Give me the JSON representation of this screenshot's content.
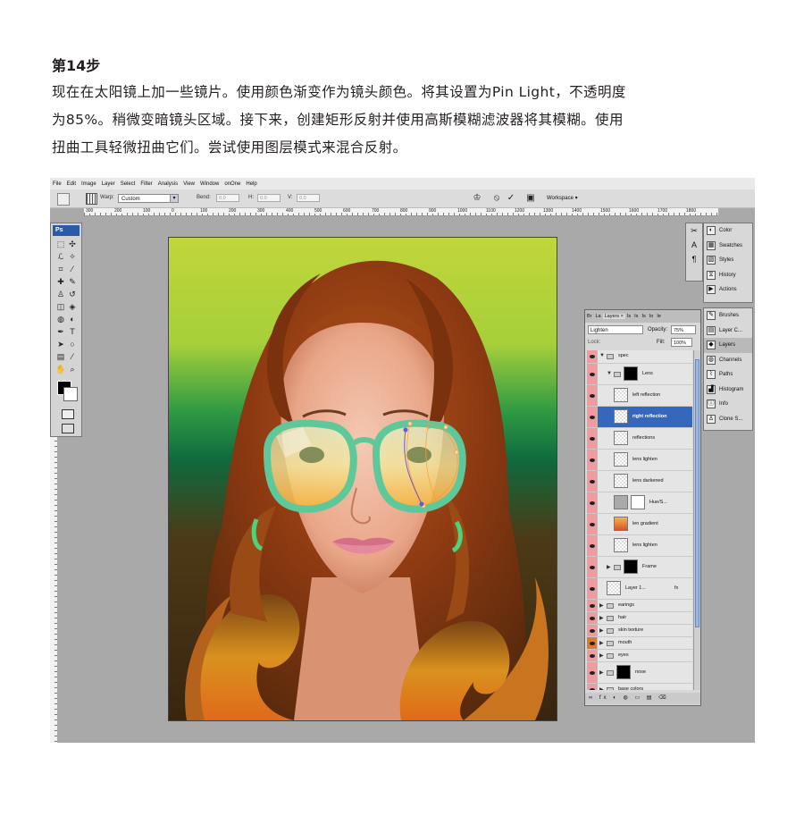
{
  "article": {
    "step_title": "第14步",
    "body_lines": [
      "现在在太阳镜上加一些镜片。使用颜色渐变作为镜头颜色。将其设置为Pin Light，不透明度",
      "为85%。稍微变暗镜头区域。接下来，创建矩形反射并使用高斯模糊滤波器将其模糊。使用",
      "扭曲工具轻微扭曲它们。尝试使用图层模式来混合反射。"
    ]
  },
  "menu": [
    "File",
    "Edit",
    "Image",
    "Layer",
    "Select",
    "Filter",
    "Analysis",
    "View",
    "Window",
    "onOne",
    "Help"
  ],
  "options_bar": {
    "warp_label": "Warp:",
    "warp_value": "Custom",
    "bend_label": "Bend:",
    "bend_value": "0.0",
    "h_label": "H:",
    "h_value": "0.0",
    "v_label": "V:",
    "v_value": "0.0",
    "workspace_label": "Workspace ▾",
    "cancel_icon": "⦸",
    "commit_icon": "✓"
  },
  "ruler_ticks": [
    "300",
    "200",
    "100",
    "0",
    "100",
    "200",
    "300",
    "400",
    "500",
    "600",
    "700",
    "800",
    "900",
    "1000",
    "1100",
    "1200",
    "1300",
    "1400",
    "1500",
    "1600",
    "1700",
    "1800"
  ],
  "toolbox": {
    "logo": "Ps",
    "tools": [
      {
        "icon": "rect-marquee-icon",
        "glyph": "⬚"
      },
      {
        "icon": "move-icon",
        "glyph": "✣"
      },
      {
        "icon": "lasso-icon",
        "glyph": "ℒ"
      },
      {
        "icon": "magic-wand-icon",
        "glyph": "✧"
      },
      {
        "icon": "crop-icon",
        "glyph": "⌗"
      },
      {
        "icon": "eyedropper-icon",
        "glyph": "⁄"
      },
      {
        "icon": "healing-brush-icon",
        "glyph": "✚"
      },
      {
        "icon": "brush-icon",
        "glyph": "✎"
      },
      {
        "icon": "clone-stamp-icon",
        "glyph": "♙"
      },
      {
        "icon": "history-brush-icon",
        "glyph": "↺"
      },
      {
        "icon": "eraser-icon",
        "glyph": "◫"
      },
      {
        "icon": "fill-icon",
        "glyph": "◈"
      },
      {
        "icon": "blur-icon",
        "glyph": "◍"
      },
      {
        "icon": "dodge-icon",
        "glyph": "◐"
      },
      {
        "icon": "pen-icon",
        "glyph": "✒"
      },
      {
        "icon": "type-icon",
        "glyph": "T"
      },
      {
        "icon": "path-select-icon",
        "glyph": "➤"
      },
      {
        "icon": "shape-icon",
        "glyph": "○"
      },
      {
        "icon": "notes-icon",
        "glyph": "▤"
      },
      {
        "icon": "eyedropper2-icon",
        "glyph": "⁄"
      },
      {
        "icon": "hand-icon",
        "glyph": "✋"
      },
      {
        "icon": "zoom-icon",
        "glyph": "⌕"
      }
    ]
  },
  "dock_icons": [
    "✂",
    "A",
    "¶"
  ],
  "panels_top": [
    {
      "label": "Color",
      "icon": "color-icon",
      "glyph": "◐"
    },
    {
      "label": "Swatches",
      "icon": "swatches-icon",
      "glyph": "▦"
    },
    {
      "label": "Styles",
      "icon": "styles-icon",
      "glyph": "▧"
    },
    {
      "label": "History",
      "icon": "history-icon",
      "glyph": "⧖"
    },
    {
      "label": "Actions",
      "icon": "actions-icon",
      "glyph": "▶"
    }
  ],
  "panels_bottom": [
    {
      "label": "Brushes",
      "icon": "brushes-icon",
      "glyph": "✎"
    },
    {
      "label": "Layer C...",
      "icon": "layer-comps-icon",
      "glyph": "▤"
    },
    {
      "label": "Layers",
      "icon": "layers-icon",
      "glyph": "◆",
      "active": true
    },
    {
      "label": "Channels",
      "icon": "channels-icon",
      "glyph": "◍"
    },
    {
      "label": "Paths",
      "icon": "paths-icon",
      "glyph": "⌇"
    },
    {
      "label": "Histogram",
      "icon": "histogram-icon",
      "glyph": "▟"
    },
    {
      "label": "Info",
      "icon": "info-icon",
      "glyph": "ⓘ"
    },
    {
      "label": "Clone S...",
      "icon": "clone-source-icon",
      "glyph": "♙"
    }
  ],
  "layers_panel": {
    "tabs": [
      "Br",
      "La",
      "Layers ×",
      "Is",
      "Is",
      "Is",
      "Io",
      "Ie"
    ],
    "blend_mode": "Lighten",
    "opacity_label": "Opacity:",
    "opacity_value": "75%",
    "lock_label": "Lock:",
    "fill_label": "Fill:",
    "fill_value": "100%",
    "bottom_icons": "∞ fx ◐ ◍ ▭ ▤ ⌫",
    "layers": [
      {
        "name": "spec",
        "kind": "group",
        "indent": 0,
        "expanded": true
      },
      {
        "name": "Lens",
        "kind": "group",
        "indent": 1,
        "expanded": true,
        "mask": true
      },
      {
        "name": "left reflection",
        "kind": "layer",
        "indent": 2
      },
      {
        "name": "right reflection",
        "kind": "layer",
        "indent": 2,
        "selected": true
      },
      {
        "name": "reflections",
        "kind": "layer",
        "indent": 2
      },
      {
        "name": "lens lighten",
        "kind": "layer",
        "indent": 2
      },
      {
        "name": "lens darkened",
        "kind": "layer",
        "indent": 2
      },
      {
        "name": "Hue/S...",
        "kind": "adjust",
        "indent": 2
      },
      {
        "name": "len gradient",
        "kind": "gradient",
        "indent": 2
      },
      {
        "name": "lens lighten",
        "kind": "layer",
        "indent": 2
      },
      {
        "name": "Frame",
        "kind": "group",
        "indent": 1,
        "mask": true
      },
      {
        "name": "Layer 1...",
        "kind": "layer",
        "indent": 1,
        "fx": "fx"
      },
      {
        "name": "earings",
        "kind": "group",
        "indent": 0,
        "small": true
      },
      {
        "name": "hair",
        "kind": "group",
        "indent": 0,
        "small": true
      },
      {
        "name": "skin texture",
        "kind": "group",
        "indent": 0,
        "small": true
      },
      {
        "name": "mouth",
        "kind": "group",
        "indent": 0,
        "small": true,
        "orange": true
      },
      {
        "name": "eyes",
        "kind": "group",
        "indent": 0,
        "small": true
      },
      {
        "name": "nose",
        "kind": "group",
        "indent": 0,
        "mask": true
      },
      {
        "name": "base colors",
        "kind": "group",
        "indent": 0,
        "small": true
      }
    ]
  }
}
